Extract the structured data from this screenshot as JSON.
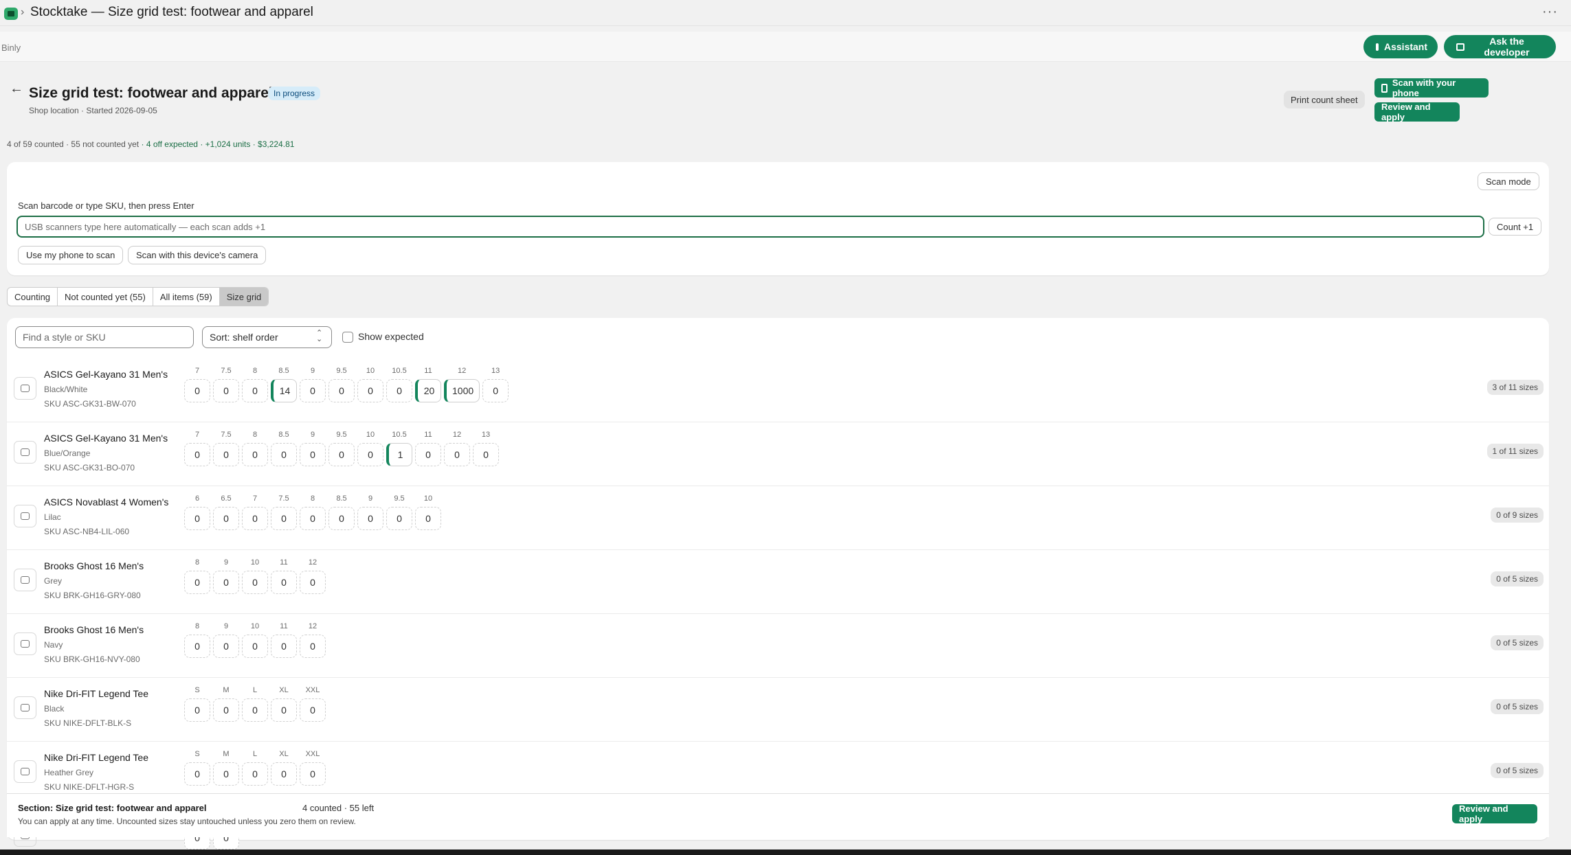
{
  "window": {
    "title": "Stocktake — Size grid test: footwear and apparel"
  },
  "app": {
    "name": "Binly",
    "assistant_label": "Assistant",
    "ask_developer_label": "Ask the developer"
  },
  "page": {
    "title": "Size grid test: footwear and apparel",
    "status": "In progress",
    "subtitle": "Shop location · Started 2026-09-05",
    "summary_main": "4 of 59 counted · 55 not counted yet",
    "summary_highlight": "· 4 off expected · +1,024 units · $3,224.81",
    "print_label": "Print count sheet",
    "scan_phone_label": "Scan with your phone",
    "review_label": "Review and apply"
  },
  "scan": {
    "mode_label": "Scan mode",
    "label": "Scan barcode or type SKU, then press Enter",
    "placeholder": "USB scanners type here automatically — each scan adds +1",
    "count_label": "Count +1",
    "use_phone_label": "Use my phone to scan",
    "device_camera_label": "Scan with this device's camera"
  },
  "tabs": [
    {
      "label": "Counting",
      "active": false
    },
    {
      "label": "Not counted yet (55)",
      "active": false
    },
    {
      "label": "All items (59)",
      "active": false
    },
    {
      "label": "Size grid",
      "active": true
    }
  ],
  "grid": {
    "search_placeholder": "Find a style or SKU",
    "sort_label": "Sort: shelf order",
    "show_expected_label": "Show expected",
    "show_expected_checked": false,
    "accent_color": "#13855c",
    "rows": [
      {
        "name": "ASICS Gel-Kayano 31 Men's",
        "variant": "Black/White",
        "sku": "SKU ASC-GK31-BW-070",
        "badge": "3 of 11 sizes",
        "sizes": [
          [
            "7",
            "0"
          ],
          [
            "7.5",
            "0"
          ],
          [
            "8",
            "0"
          ],
          [
            "8.5",
            "14"
          ],
          [
            "9",
            "0"
          ],
          [
            "9.5",
            "0"
          ],
          [
            "10",
            "0"
          ],
          [
            "10.5",
            "0"
          ],
          [
            "11",
            "20"
          ],
          [
            "12",
            "1000"
          ],
          [
            "13",
            "0"
          ]
        ],
        "filled": [
          3,
          8,
          9
        ]
      },
      {
        "name": "ASICS Gel-Kayano 31 Men's",
        "variant": "Blue/Orange",
        "sku": "SKU ASC-GK31-BO-070",
        "badge": "1 of 11 sizes",
        "sizes": [
          [
            "7",
            "0"
          ],
          [
            "7.5",
            "0"
          ],
          [
            "8",
            "0"
          ],
          [
            "8.5",
            "0"
          ],
          [
            "9",
            "0"
          ],
          [
            "9.5",
            "0"
          ],
          [
            "10",
            "0"
          ],
          [
            "10.5",
            "1"
          ],
          [
            "11",
            "0"
          ],
          [
            "12",
            "0"
          ],
          [
            "13",
            "0"
          ]
        ],
        "filled": [
          7
        ]
      },
      {
        "name": "ASICS Novablast 4 Women's",
        "variant": "Lilac",
        "sku": "SKU ASC-NB4-LIL-060",
        "badge": "0 of 9 sizes",
        "sizes": [
          [
            "6",
            "0"
          ],
          [
            "6.5",
            "0"
          ],
          [
            "7",
            "0"
          ],
          [
            "7.5",
            "0"
          ],
          [
            "8",
            "0"
          ],
          [
            "8.5",
            "0"
          ],
          [
            "9",
            "0"
          ],
          [
            "9.5",
            "0"
          ],
          [
            "10",
            "0"
          ]
        ],
        "filled": []
      },
      {
        "name": "Brooks Ghost 16 Men's",
        "variant": "Grey",
        "sku": "SKU BRK-GH16-GRY-080",
        "badge": "0 of 5 sizes",
        "sizes": [
          [
            "8",
            "0"
          ],
          [
            "9",
            "0"
          ],
          [
            "10",
            "0"
          ],
          [
            "11",
            "0"
          ],
          [
            "12",
            "0"
          ]
        ],
        "filled": []
      },
      {
        "name": "Brooks Ghost 16 Men's",
        "variant": "Navy",
        "sku": "SKU BRK-GH16-NVY-080",
        "badge": "0 of 5 sizes",
        "sizes": [
          [
            "8",
            "0"
          ],
          [
            "9",
            "0"
          ],
          [
            "10",
            "0"
          ],
          [
            "11",
            "0"
          ],
          [
            "12",
            "0"
          ]
        ],
        "filled": []
      },
      {
        "name": "Nike Dri-FIT Legend Tee",
        "variant": "Black",
        "sku": "SKU NIKE-DFLT-BLK-S",
        "badge": "0 of 5 sizes",
        "sizes": [
          [
            "S",
            "0"
          ],
          [
            "M",
            "0"
          ],
          [
            "L",
            "0"
          ],
          [
            "XL",
            "0"
          ],
          [
            "XXL",
            "0"
          ]
        ],
        "filled": []
      },
      {
        "name": "Nike Dri-FIT Legend Tee",
        "variant": "Heather Grey",
        "sku": "SKU NIKE-DFLT-HGR-S",
        "badge": "0 of 5 sizes",
        "sizes": [
          [
            "S",
            "0"
          ],
          [
            "M",
            "0"
          ],
          [
            "L",
            "0"
          ],
          [
            "XL",
            "0"
          ],
          [
            "XXL",
            "0"
          ]
        ],
        "filled": []
      },
      {
        "name": "",
        "variant": "",
        "sku": "",
        "badge": "",
        "sizes": [
          [
            "",
            "0"
          ],
          [
            "",
            "0"
          ]
        ],
        "filled": []
      }
    ]
  },
  "footer": {
    "section": "Section: Size grid test: footwear and apparel",
    "counts": "4 counted · 55 left",
    "note": "You can apply at any time. Uncounted sizes stay untouched unless you zero them on review.",
    "review_label": "Review and apply"
  }
}
